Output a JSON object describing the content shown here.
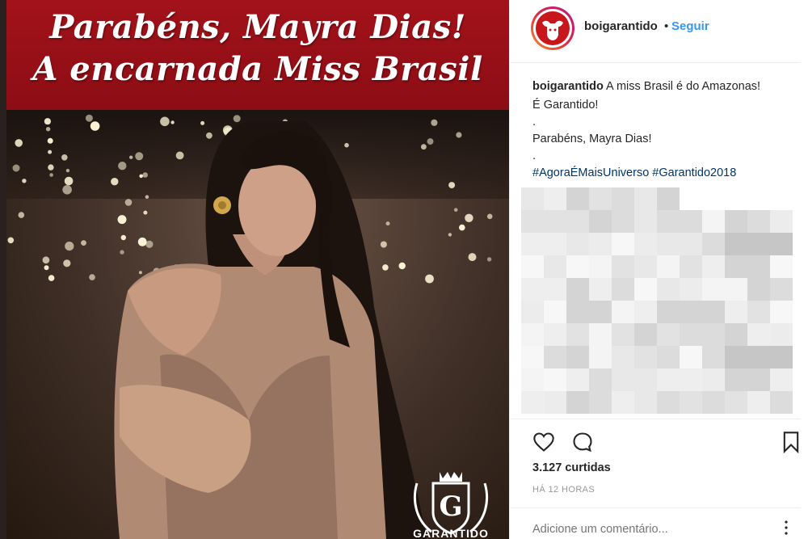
{
  "post_image": {
    "banner_line1": "Parabéns, Mayra Dias!",
    "banner_line2": "A encarnada Miss Brasil",
    "logo_text": "GARANTIDO",
    "banner_color": "#a3121a"
  },
  "header": {
    "username": "boigarantido",
    "separator": "•",
    "follow_label": "Seguir"
  },
  "caption": {
    "username": "boigarantido",
    "line1": "A miss Brasil é do Amazonas!",
    "line2": "É Garantido!",
    "dot1": ".",
    "line3": "Parabéns, Mayra Dias!",
    "dot2": ".",
    "hashtag1": "#AgoraÉMaisUniverso",
    "hashtag2": "#Garantido2018"
  },
  "actions": {
    "like_icon": "heart-icon",
    "comment_icon": "comment-icon",
    "save_icon": "bookmark-icon"
  },
  "likes": "3.127 curtidas",
  "timestamp": "HÁ 12 HORAS",
  "comment": {
    "placeholder": "Adicione um comentário..."
  },
  "colors": {
    "link_blue": "#3897f0",
    "hashtag_blue": "#003569"
  }
}
